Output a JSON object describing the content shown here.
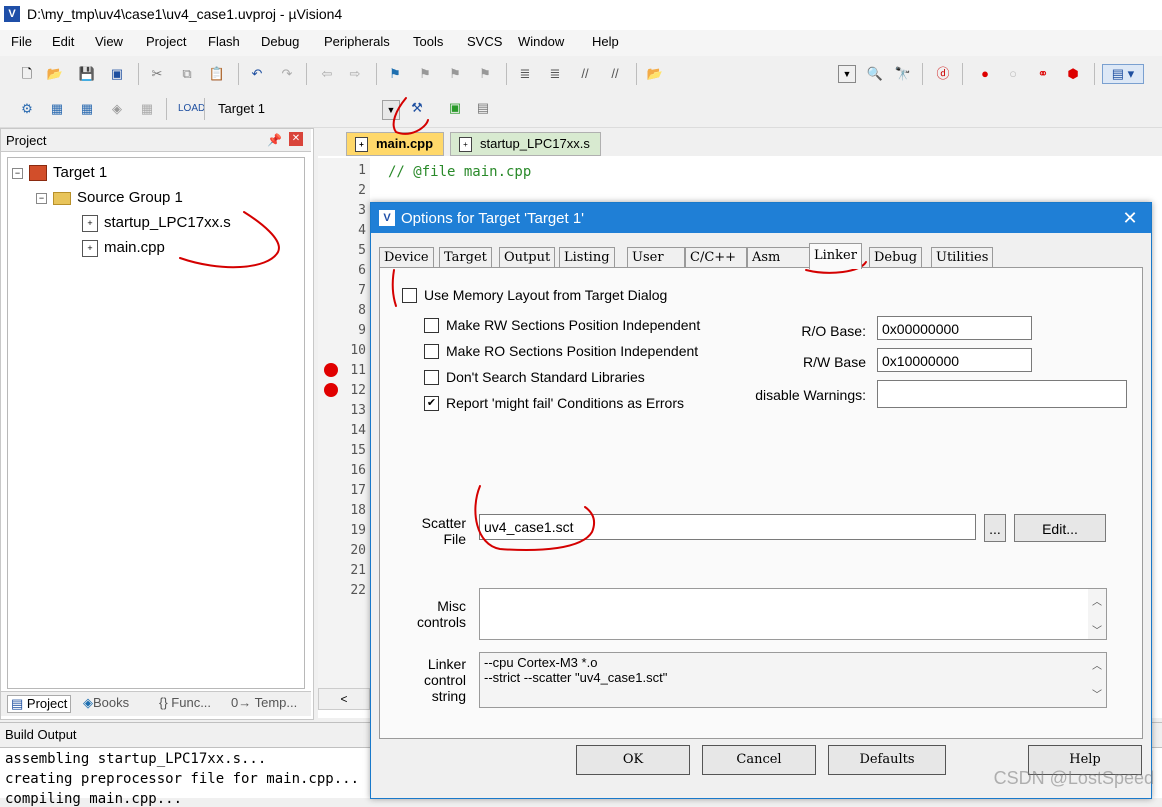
{
  "window": {
    "title": "D:\\my_tmp\\uv4\\case1\\uv4_case1.uvproj - µVision4",
    "app_icon": "uv4-logo-icon"
  },
  "menu": [
    "File",
    "Edit",
    "View",
    "Project",
    "Flash",
    "Debug",
    "Peripherals",
    "Tools",
    "SVCS",
    "Window",
    "Help"
  ],
  "toolbar2": {
    "target_value": "Target 1"
  },
  "project_panel": {
    "title": "Project",
    "tree": {
      "target": "Target 1",
      "group": "Source Group 1",
      "files": [
        "startup_LPC17xx.s",
        "main.cpp"
      ]
    },
    "tabs": [
      "Project",
      "Books",
      "{} Func...",
      "0→ Temp..."
    ]
  },
  "editor": {
    "tabs": [
      "main.cpp",
      "startup_LPC17xx.s"
    ],
    "line_numbers": [
      "1",
      "2",
      "3",
      "4",
      "5",
      "6",
      "7",
      "8",
      "9",
      "10",
      "11",
      "12",
      "13",
      "14",
      "15",
      "16",
      "17",
      "18",
      "19",
      "20",
      "21",
      "22"
    ],
    "breakpoint_lines": [
      "11",
      "12"
    ],
    "code_line_1": "// @file main.cpp",
    "scroll_left": "<"
  },
  "build_output": {
    "title": "Build Output",
    "lines": [
      "assembling startup_LPC17xx.s...",
      "creating preprocessor file for main.cpp...",
      "compiling main.cpp..."
    ]
  },
  "dialog": {
    "title": "Options for Target 'Target 1'",
    "close": "✕",
    "tabs": [
      "Device",
      "Target",
      "Output",
      "Listing",
      "User",
      "C/C++",
      "Asm",
      "Linker",
      "Debug",
      "Utilities"
    ],
    "active_tab": "Linker",
    "use_memory_layout": {
      "label": "Use Memory Layout from Target Dialog",
      "checked": false
    },
    "options": [
      {
        "label": "Make RW Sections Position Independent",
        "checked": false
      },
      {
        "label": "Make RO Sections Position Independent",
        "checked": false
      },
      {
        "label": "Don't Search Standard Libraries",
        "checked": false
      },
      {
        "label": "Report 'might fail' Conditions as Errors",
        "checked": true
      }
    ],
    "ro_base_label": "R/O Base:",
    "ro_base": "0x00000000",
    "rw_base_label": "R/W Base",
    "rw_base": "0x10000000",
    "disable_warnings_label": "disable Warnings:",
    "disable_warnings": "",
    "scatter_label_1": "Scatter",
    "scatter_label_2": "File",
    "scatter_file": "uv4_case1.sct",
    "browse_label": "...",
    "edit_label": "Edit...",
    "misc_label_1": "Misc",
    "misc_label_2": "controls",
    "misc_controls": "",
    "linker_label_1": "Linker",
    "linker_label_2": "control",
    "linker_label_3": "string",
    "linker_string_1": "--cpu Cortex-M3 *.o",
    "linker_string_2": "--strict --scatter \"uv4_case1.sct\"",
    "buttons": {
      "ok": "OK",
      "cancel": "Cancel",
      "defaults": "Defaults",
      "help": "Help"
    }
  },
  "watermark": "CSDN @LostSpeed",
  "colors": {
    "dialog_title": "#1f7fd6",
    "annotation": "#d40000",
    "active_tab": "#ffd86a",
    "breakpoint": "#e00000"
  }
}
